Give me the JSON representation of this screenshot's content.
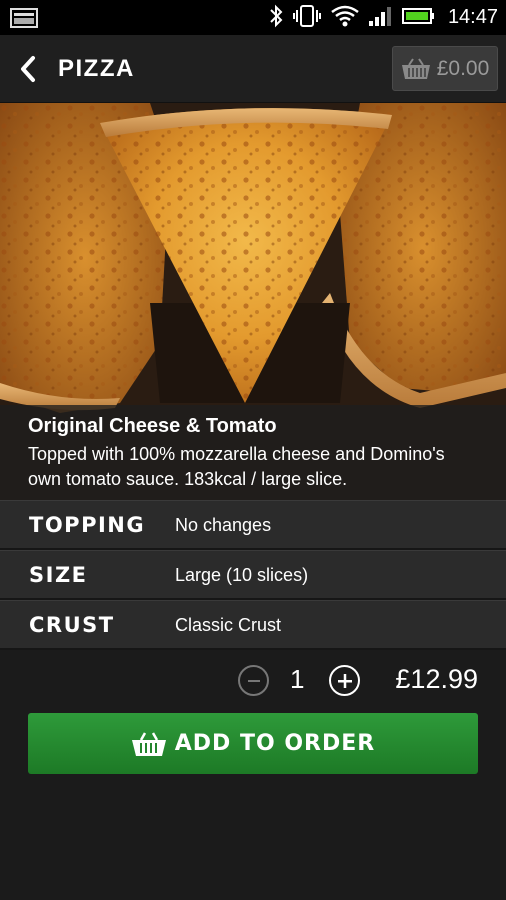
{
  "status_bar": {
    "time": "14:47",
    "icons": [
      "screenshot-icon",
      "bluetooth-icon",
      "vibrate-icon",
      "wifi-icon",
      "signal-icon",
      "battery-icon"
    ]
  },
  "header": {
    "title": "PIZZA",
    "basket_total": "£0.00"
  },
  "product": {
    "name": "Original Cheese & Tomato",
    "description": "Topped with 100% mozzarella cheese and Domino's own tomato sauce. 183kcal / large slice."
  },
  "options": [
    {
      "label": "TOPPING",
      "value": "No changes"
    },
    {
      "label": "SIZE",
      "value": "Large (10 slices)"
    },
    {
      "label": "CRUST",
      "value": "Classic Crust"
    }
  ],
  "order": {
    "quantity": "1",
    "price": "£12.99",
    "add_label": "ADD TO ORDER"
  },
  "colors": {
    "accent_green": "#23852d",
    "background": "#1b1b1b"
  }
}
